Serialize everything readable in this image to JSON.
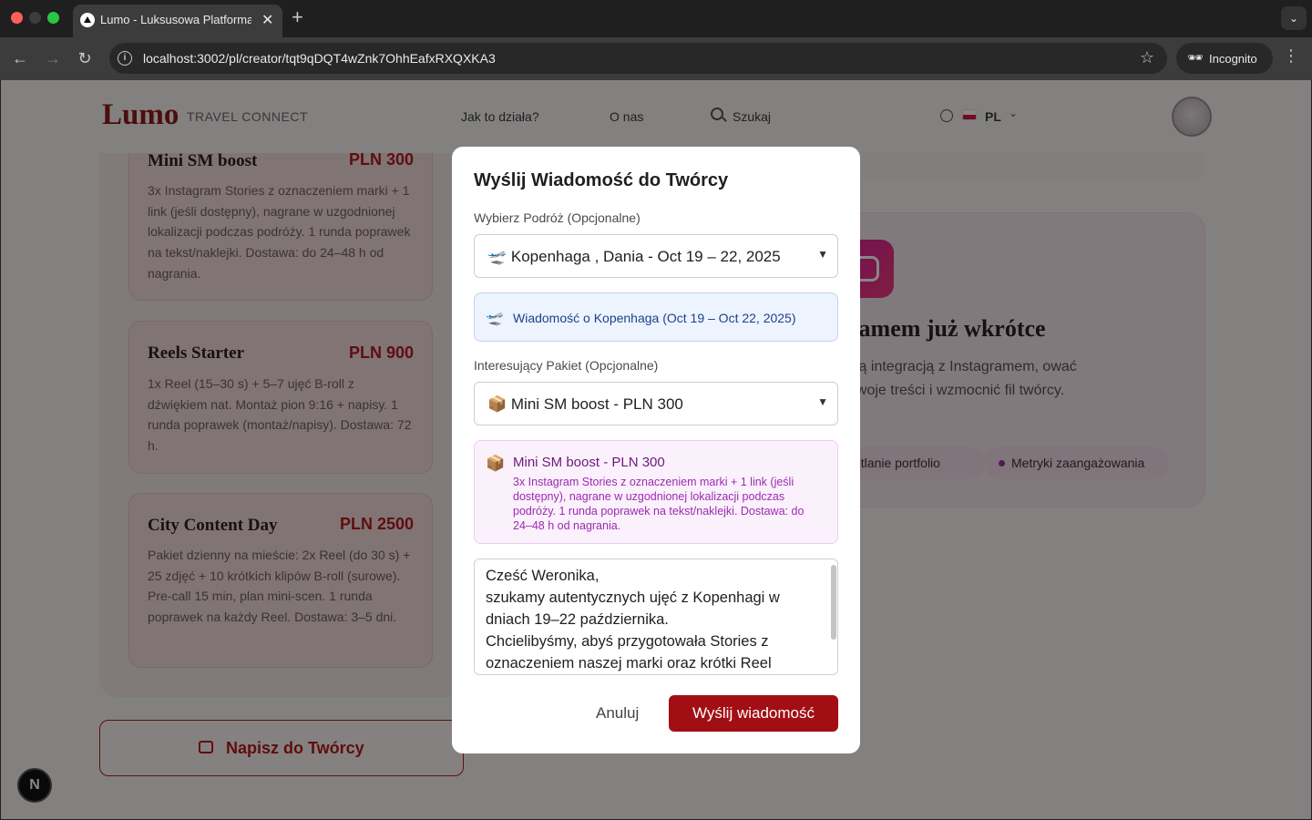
{
  "browser": {
    "tab_title": "Lumo - Luksusowa Platforma",
    "url": "localhost:3002/pl/creator/tqt9qDQT4wZnk7OhhEafxRXQXKA3",
    "incognito_label": "Incognito"
  },
  "header": {
    "logo": "Lumo",
    "logo_sub": "TRAVEL CONNECT",
    "nav": [
      "Jak to działa?",
      "O nas"
    ],
    "search_label": "Szukaj",
    "lang": "PL"
  },
  "packages": [
    {
      "name": "Mini SM boost",
      "price": "PLN 300",
      "desc": "3x Instagram Stories z oznaczeniem marki + 1 link (jeśli dostępny), nagrane w uzgodnionej lokalizacji podczas podróży. 1 runda poprawek na tekst/naklejki. Dostawa: do 24–48 h od nagrania."
    },
    {
      "name": "Reels Starter",
      "price": "PLN 900",
      "desc": "1x Reel (15–30 s) + 5–7 ujęć B-roll z dźwiękiem nat. Montaż pion 9:16 + napisy. 1 runda poprawek (montaż/napisy). Dostawa: 72 h."
    },
    {
      "name": "City Content Day",
      "price": "PLN 2500",
      "desc": "Pakiet dzienny na mieście: 2x Reel (do 30 s) + 25 zdjęć + 10 krótkich klipów B-roll (surowe). Pre-call 15 min, plan mini-scen. 1 runda poprawek na każdy Reel. Dostawa: 3–5 dni."
    }
  ],
  "contact_button": "Napisz do Twórcy",
  "instagram": {
    "title": "ramem już wkrótce",
    "desc": "wą integracją z Instagramem, ować Twoje treści i wzmocnić fil twórcy.",
    "chips": [
      "etlanie portfolio",
      "Metryki zaangażowania"
    ]
  },
  "modal": {
    "title": "Wyślij Wiadomość do Twórcy",
    "trip_label": "Wybierz Podróż (Opcjonalne)",
    "trip_value": "🛫 Kopenhaga , Dania - Oct 19 – 22, 2025",
    "trip_info": "Wiadomość o Kopenhaga (Oct 19 – Oct 22, 2025)",
    "package_label": "Interesujący Pakiet (Opcjonalne)",
    "package_value": "📦 Mini SM boost - PLN 300",
    "package_info_title": "Mini SM boost - PLN 300",
    "package_info_desc": "3x Instagram Stories z oznaczeniem marki + 1 link (jeśli dostępny), nagrane w uzgodnionej lokalizacji podczas podróży. 1 runda poprawek na tekst/naklejki. Dostawa: do 24–48 h od nagrania.",
    "message": "Cześć Weronika,\nszukamy autentycznych ujęć z Kopenhagi w dniach 19–22 października.\nChcielibyśmy, abyś przygotowała Stories z oznaczeniem naszej marki oraz krótki Reel",
    "cancel_label": "Anuluj",
    "send_label": "Wyślij wiadomość"
  },
  "dev_badge": "N"
}
